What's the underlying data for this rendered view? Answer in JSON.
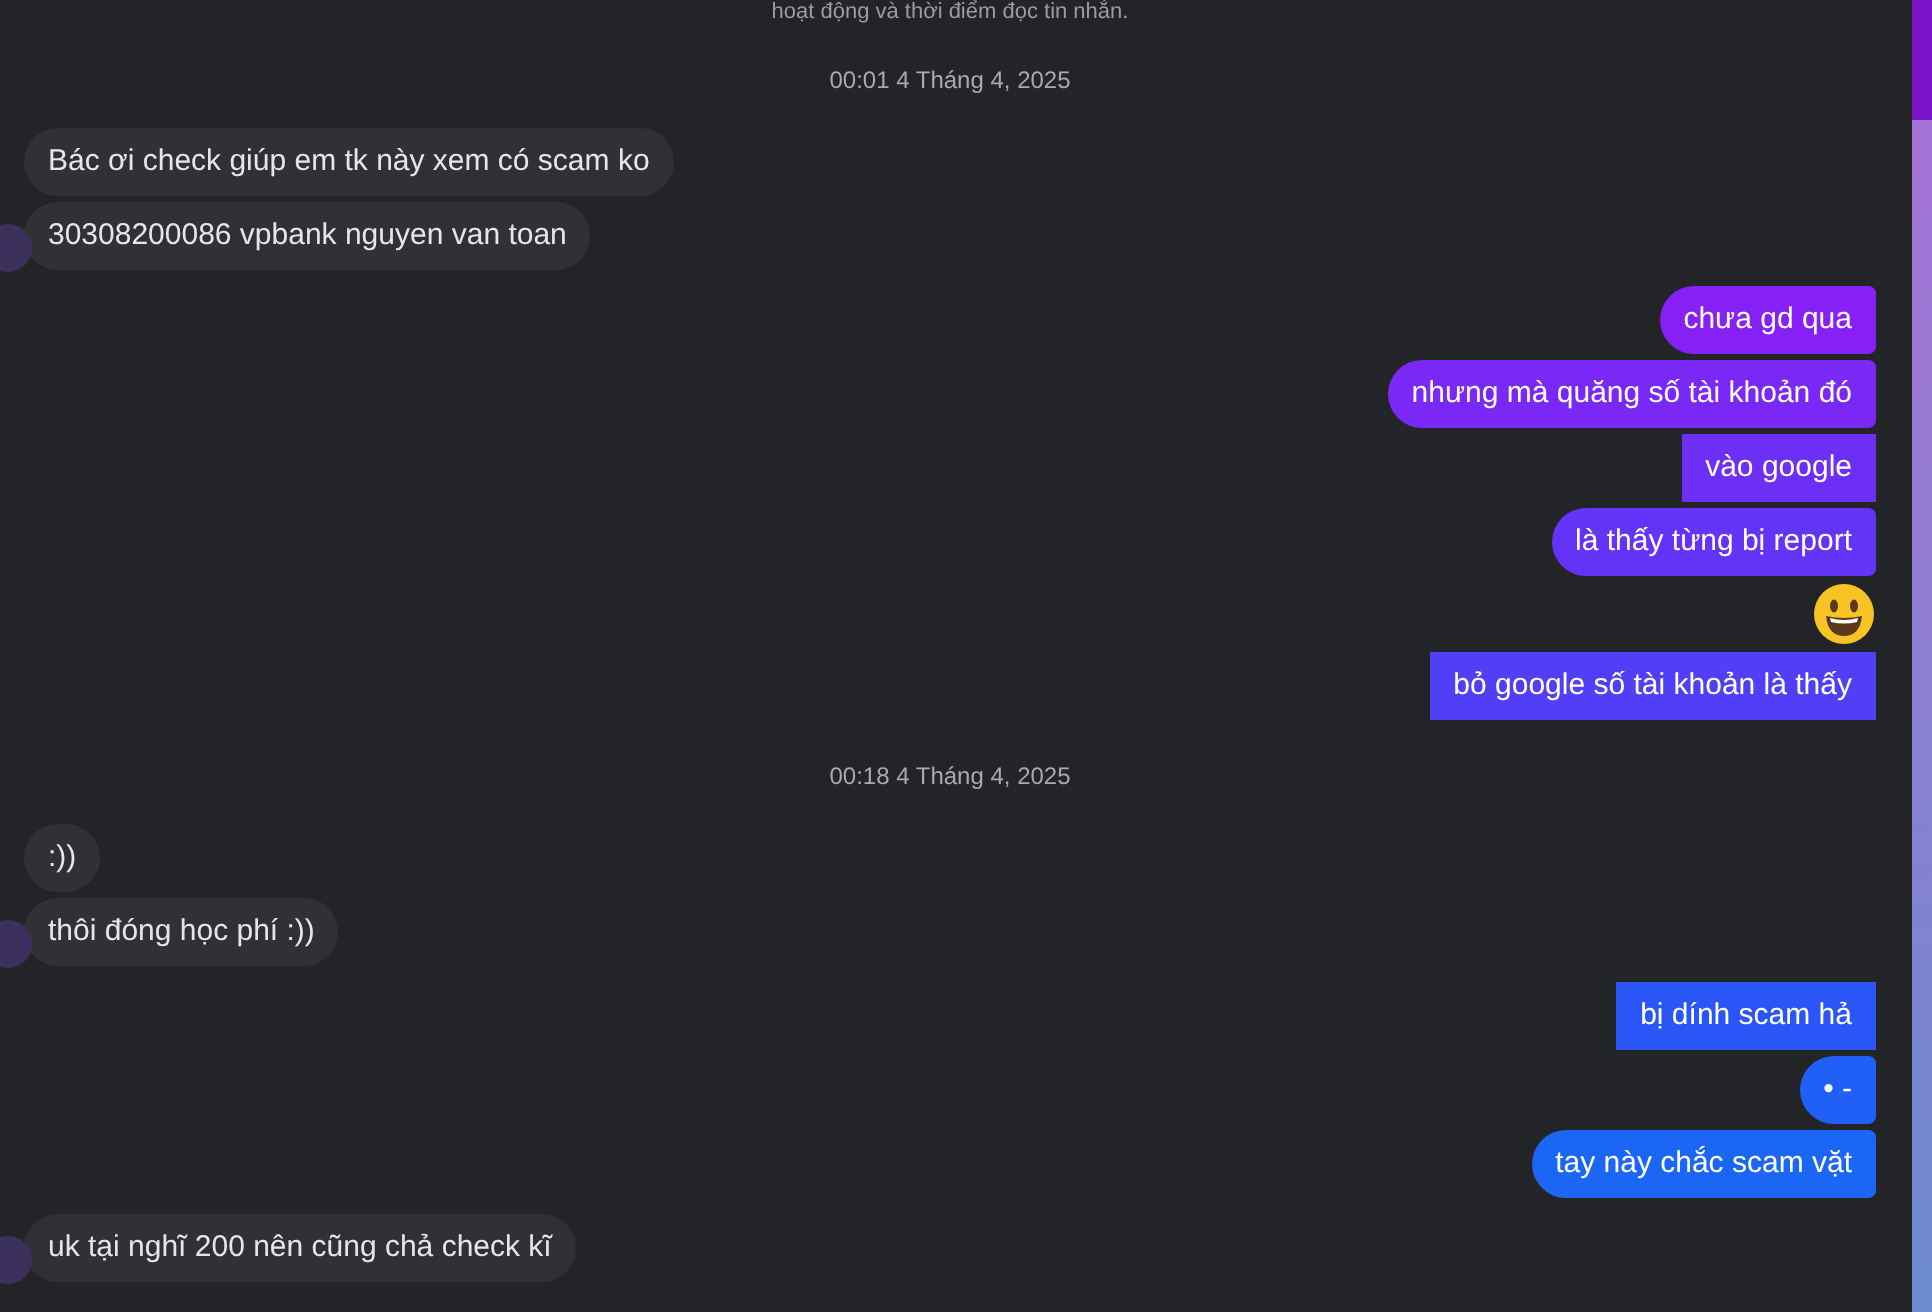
{
  "notice": "hoạt động và thời điểm đọc tin nhắn.",
  "sections": [
    {
      "kind": "time",
      "text": "00:01 4 Tháng 4, 2025"
    },
    {
      "kind": "in",
      "messages": [
        {
          "text": "Bác ơi check giúp em tk này xem có scam ko"
        },
        {
          "text": "30308200086 vpbank nguyen van toan"
        }
      ]
    },
    {
      "kind": "out",
      "messages": [
        {
          "kind": "text",
          "text": "chưa gd qua",
          "color": "#8620f7",
          "rounded": true
        },
        {
          "kind": "text",
          "text": "nhưng mà quăng số tài khoản đó",
          "color": "#7a28f6",
          "rounded": true
        },
        {
          "kind": "text",
          "text": "vào google",
          "color": "#6d2ff6",
          "rounded": false
        },
        {
          "kind": "text",
          "text": "là thấy từng bị report",
          "color": "#6334f7",
          "rounded": true
        },
        {
          "kind": "emoji"
        },
        {
          "kind": "text",
          "text": "bỏ google số tài khoản là thấy",
          "color": "#513ef7",
          "rounded": false
        }
      ]
    },
    {
      "kind": "time",
      "text": "00:18 4 Tháng 4, 2025"
    },
    {
      "kind": "in",
      "messages": [
        {
          "text": ":))"
        },
        {
          "text": "thôi đóng học phí :))"
        }
      ]
    },
    {
      "kind": "out",
      "messages": [
        {
          "kind": "text",
          "text": "bị dính scam hả",
          "color": "#2a55f7",
          "rounded": false
        },
        {
          "kind": "text",
          "text": "• -",
          "color": "#2160f6",
          "rounded": true
        },
        {
          "kind": "text",
          "text": "tay này chắc scam vặt",
          "color": "#1c66f5",
          "rounded": true
        }
      ]
    },
    {
      "kind": "in",
      "messages": [
        {
          "text": "uk tại nghĩ 200 nên cũng chả check kĩ"
        }
      ]
    }
  ]
}
